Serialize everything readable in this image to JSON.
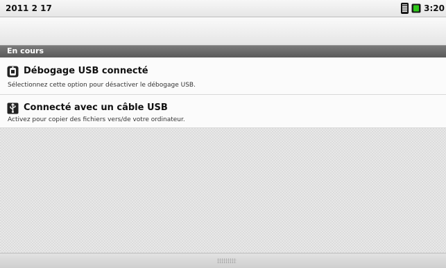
{
  "status_bar": {
    "date": "2011 2 17",
    "time": "3:20",
    "icons": [
      "signal-icon",
      "battery-icon"
    ],
    "battery_color": "#2ec81a"
  },
  "section": {
    "title": "En cours"
  },
  "notifications": [
    {
      "icon": "usb-debug-icon",
      "title": "Débogage USB connecté",
      "text": "Sélectionnez cette option pour désactiver le débogage USB."
    },
    {
      "icon": "usb-icon",
      "title": "Connecté avec un câble USB",
      "text": "Activez pour copier des fichiers vers/de votre ordinateur."
    }
  ],
  "colors": {
    "section_header": "#6a6a6a",
    "item_background": "#fbfbfb"
  }
}
